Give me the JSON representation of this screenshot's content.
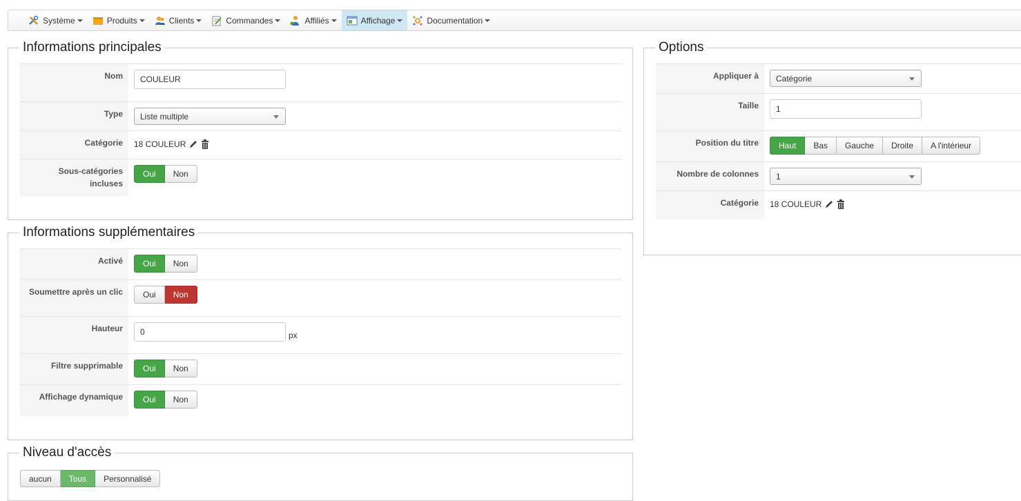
{
  "menu": [
    {
      "label": "Système",
      "icon": "tools-icon"
    },
    {
      "label": "Produits",
      "icon": "products-icon"
    },
    {
      "label": "Clients",
      "icon": "users-icon"
    },
    {
      "label": "Commandes",
      "icon": "orders-icon"
    },
    {
      "label": "Affiliés",
      "icon": "affiliates-icon"
    },
    {
      "label": "Affichage",
      "icon": "display-icon",
      "active": true
    },
    {
      "label": "Documentation",
      "icon": "documentation-icon"
    }
  ],
  "main_info": {
    "legend": "Informations principales",
    "nom_label": "Nom",
    "nom_value": "COULEUR",
    "type_label": "Type",
    "type_value": "Liste multiple",
    "categorie_label": "Catégorie",
    "categorie_value": "18 COULEUR",
    "sous_cat_label": "Sous-catégories incluses",
    "sous_cat_oui": "Oui",
    "sous_cat_non": "Non",
    "sous_cat_selected": "Oui"
  },
  "extra_info": {
    "legend": "Informations supplémentaires",
    "active_label": "Activé",
    "active_oui": "Oui",
    "active_non": "Non",
    "submit_label": "Soumettre après un clic",
    "submit_oui": "Oui",
    "submit_non": "Non",
    "hauteur_label": "Hauteur",
    "hauteur_value": "0",
    "hauteur_unit": "px",
    "filtre_label": "Filtre supprimable",
    "filtre_oui": "Oui",
    "filtre_non": "Non",
    "dyn_label": "Affichage dynamique",
    "dyn_oui": "Oui",
    "dyn_non": "Non"
  },
  "access": {
    "legend": "Niveau d'accès",
    "aucun": "aucun",
    "tous": "Tous",
    "perso": "Personnalisé"
  },
  "options": {
    "legend": "Options",
    "appliquer_label": "Appliquer à",
    "appliquer_value": "Catégorie",
    "taille_label": "Taille",
    "taille_value": "1",
    "position_label": "Position du titre",
    "pos_haut": "Haut",
    "pos_bas": "Bas",
    "pos_gauche": "Gauche",
    "pos_droite": "Droite",
    "pos_interieur": "A l'intérieur",
    "colonnes_label": "Nombre de colonnes",
    "colonnes_value": "1",
    "categorie_label": "Catégorie",
    "categorie_value": "18 COULEUR"
  },
  "colors": {
    "green": "#46a546",
    "red": "#bd362f",
    "menu_active": "#cfe6f3"
  }
}
